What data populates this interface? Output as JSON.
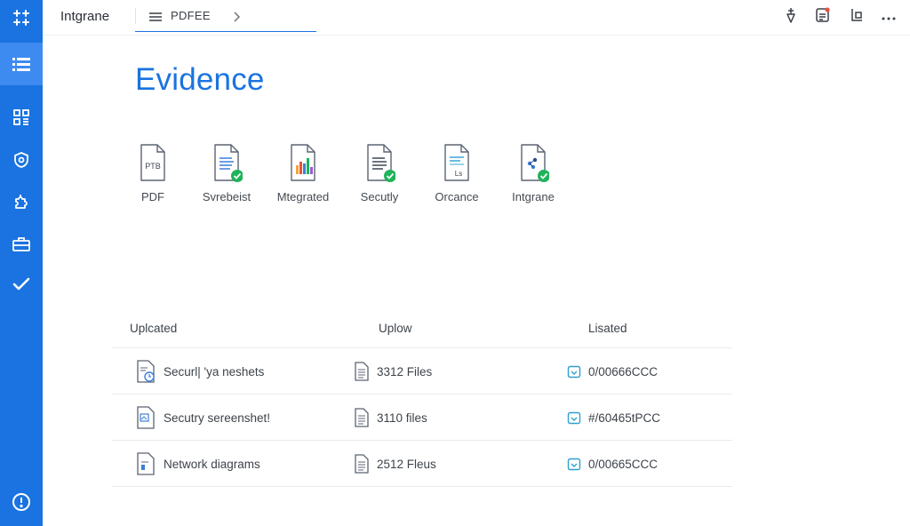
{
  "app": {
    "title": "Intgrane",
    "brand_color": "#1a73e0",
    "logo_icon": "app-logo-icon"
  },
  "rail": {
    "items": [
      {
        "icon": "list-icon",
        "active": true
      },
      {
        "icon": "grid-icon",
        "active": false
      },
      {
        "icon": "shield-icon",
        "active": false
      },
      {
        "icon": "puzzle-icon",
        "active": false
      },
      {
        "icon": "briefcase-icon",
        "active": false
      },
      {
        "icon": "check-icon",
        "active": false
      }
    ],
    "help_icon": "alert-circle-icon"
  },
  "breadcrumb": {
    "menu_icon": "menu-icon",
    "label": "PDFEE",
    "chevron_icon": "chevron-right-icon"
  },
  "top_actions": [
    {
      "icon": "pin-icon"
    },
    {
      "icon": "notification-icon",
      "badge_color": "#e5533d"
    },
    {
      "icon": "share-icon"
    },
    {
      "icon": "more-icon"
    }
  ],
  "page": {
    "title": "Evidence"
  },
  "evidence_types": [
    {
      "label": "PDF",
      "icon": "pdf-file-icon",
      "icon_text": "PTB",
      "verified": false
    },
    {
      "label": "Svrebeist",
      "icon": "document-icon",
      "verified": true
    },
    {
      "label": "Mtegrated",
      "icon": "chart-file-icon",
      "verified": false
    },
    {
      "label": "Secutly",
      "icon": "document-icon",
      "verified": true
    },
    {
      "label": "Orcance",
      "icon": "form-file-icon",
      "icon_text": "Ls",
      "verified": false
    },
    {
      "label": "Intgrane",
      "icon": "diagram-file-icon",
      "verified": true
    }
  ],
  "table": {
    "columns": [
      "Uplcated",
      "Uplow",
      "Lisated"
    ],
    "rows": [
      {
        "name": "Securl| 'ya neshets",
        "files": "3312 Files",
        "date": "0/00666CCC"
      },
      {
        "name": "Secutry sereenshet!",
        "files": "3110 files",
        "date": "#/60465tPCC"
      },
      {
        "name": "Network diagrams",
        "files": "2512 Fleus",
        "date": "0/00665CCC"
      }
    ]
  },
  "colors": {
    "accent": "#1a73e0",
    "verified": "#1fb35a",
    "text": "#3d434a"
  }
}
